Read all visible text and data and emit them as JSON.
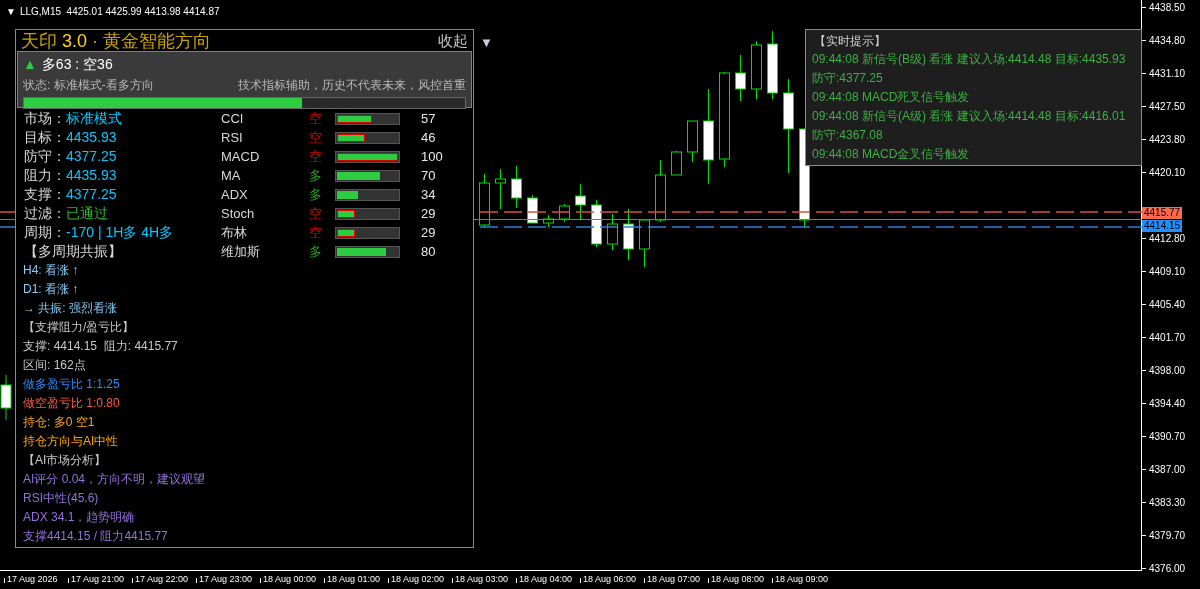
{
  "symbol_bar": {
    "caret": "▼",
    "text": "LLG,M15  4425.01 4425.99 4413.98 4414.87"
  },
  "panel": {
    "title": {
      "name": "天印",
      "version": "3.0",
      "tagline": "· 黄金智能方向"
    },
    "collapse": "收起",
    "menu_caret": "▼",
    "score": {
      "arrow": "▲",
      "text": "多63 : 空36",
      "status": "状态: 标准模式-看多方向",
      "disclaimer": "技术指标辅助，历史不代表未来，风控首重",
      "level": 0.63
    },
    "facts": [
      {
        "label": "市场：",
        "value": "标准模式",
        "kind": "value"
      },
      {
        "label": "目标：",
        "value": "4435.93",
        "kind": "value"
      },
      {
        "label": "防守：",
        "value": "4377.25",
        "kind": "value"
      },
      {
        "label": "阻力：",
        "value": "4435.93",
        "kind": "value"
      },
      {
        "label": "支撑：",
        "value": "4377.25",
        "kind": "value"
      },
      {
        "label": "过滤：",
        "value": "已通过",
        "kind": "passed"
      },
      {
        "label": "周期：",
        "value": "-170 | 1H多 4H多",
        "kind": "value"
      },
      {
        "label": "【多周期共振】",
        "kind": "header"
      }
    ],
    "indicators": [
      {
        "name": "CCI",
        "signal": "空",
        "bearish": true,
        "level": 0.57,
        "value": "57"
      },
      {
        "name": "RSI",
        "signal": "空",
        "bearish": true,
        "level": 0.46,
        "value": "46"
      },
      {
        "name": "MACD",
        "signal": "空",
        "bearish": true,
        "level": 1,
        "value": "100"
      },
      {
        "name": "MA",
        "signal": "多",
        "bearish": false,
        "level": 0.7,
        "value": "70"
      },
      {
        "name": "ADX",
        "signal": "多",
        "bearish": false,
        "level": 0.34,
        "value": "34"
      },
      {
        "name": "Stoch",
        "signal": "空",
        "bearish": true,
        "level": 0.29,
        "value": "29"
      },
      {
        "name": "布林",
        "signal": "空",
        "bearish": true,
        "level": 0.29,
        "value": "29"
      },
      {
        "name": "维加斯",
        "signal": "多",
        "bearish": false,
        "level": 0.8,
        "value": "80"
      }
    ],
    "notes": [
      {
        "kind": "trend",
        "text": "H4: 看涨 ↑"
      },
      {
        "kind": "trend",
        "text": "D1: 看涨 ↑"
      },
      {
        "kind": "trend",
        "text": "→ 共振: 强烈看涨"
      },
      {
        "kind": "header",
        "text": "【支撑阻力/盈亏比】"
      },
      {
        "kind": "info",
        "text": "支撑: 4414.15  阻力: 4415.77"
      },
      {
        "kind": "info",
        "text": "区间: 162点"
      },
      {
        "kind": "long",
        "text": "做多盈亏比 1:1.25"
      },
      {
        "kind": "short",
        "text": "做空盈亏比 1:0.80"
      },
      {
        "kind": "position",
        "text": "持仓: 多0 空1"
      },
      {
        "kind": "position",
        "text": "持仓方向与AI中性"
      },
      {
        "kind": "header",
        "text": "【AI市场分析】"
      },
      {
        "kind": "ai",
        "text": "AI评分 0.04，方向不明，建议观望"
      },
      {
        "kind": "ai",
        "text": "RSI中性(45.6)"
      },
      {
        "kind": "ai",
        "text": "ADX 34.1，趋势明确"
      },
      {
        "kind": "ai",
        "text": "支撑4414.15 / 阻力4415.77"
      }
    ]
  },
  "alerts": {
    "title": "【实时提示】",
    "lines": [
      "09:44:08 新信号(B级) 看涨 建议入场:4414.48 目标:4435.93",
      "防守:4377.25",
      "09:44:08 MACD死叉信号触发",
      "09:44:08 新信号(A级) 看涨 建议入场:4414.48 目标:4416.01",
      "防守:4367.08",
      "09:44:08 MACD金叉信号触发"
    ]
  },
  "price_axis": {
    "upper": [
      "4438.50",
      "4434.80",
      "4431.10",
      "4427.50",
      "4423.80",
      "4420.10"
    ],
    "lower": [
      "4412.80",
      "4409.10",
      "4405.40",
      "4401.70",
      "4398.00",
      "4394.40",
      "4390.70",
      "4387.00",
      "4383.30",
      "4379.70",
      "4376.00"
    ],
    "tags": [
      {
        "text": "4415.77",
        "color": "#ff6a4d"
      },
      {
        "text": "4414.15",
        "color": "#1e90ff"
      }
    ]
  },
  "time_axis": [
    "17 Aug 2026",
    "17 Aug 21:00",
    "17 Aug 22:00",
    "17 Aug 23:00",
    "18 Aug 00:00",
    "18 Aug 01:00",
    "18 Aug 02:00",
    "18 Aug 03:00",
    "18 Aug 04:00",
    "18 Aug 06:00",
    "18 Aug 07:00",
    "18 Aug 08:00",
    "18 Aug 09:00"
  ]
}
